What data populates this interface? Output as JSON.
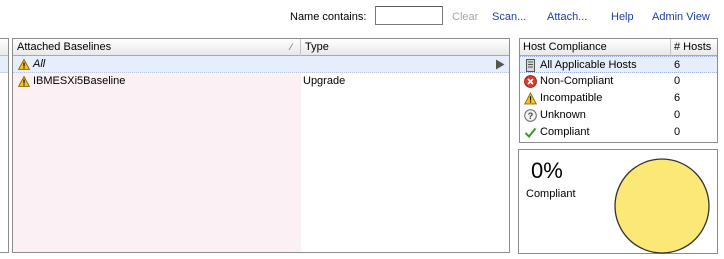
{
  "toolbar": {
    "name_contains_label": "Name contains:",
    "name_contains_value": "",
    "clear_label": "Clear",
    "scan_label": "Scan...",
    "attach_label": "Attach...",
    "help_label": "Help",
    "admin_view_label": "Admin View"
  },
  "baselines": {
    "columns": [
      "Attached Baselines",
      "Type"
    ],
    "sort_indicator": "⁄",
    "rows": [
      {
        "name": "All",
        "type": "",
        "icon": "warning-icon"
      },
      {
        "name": "IBMESXi5Baseline",
        "type": "Upgrade",
        "icon": "warning-icon"
      }
    ]
  },
  "host_compliance": {
    "columns": [
      "Host Compliance",
      "# Hosts"
    ],
    "rows": [
      {
        "label": "All Applicable Hosts",
        "count": "6",
        "icon": "host-icon"
      },
      {
        "label": "Non-Compliant",
        "count": "0",
        "icon": "error-icon"
      },
      {
        "label": "Incompatible",
        "count": "6",
        "icon": "warning-icon"
      },
      {
        "label": "Unknown",
        "count": "0",
        "icon": "unknown-icon"
      },
      {
        "label": "Compliant",
        "count": "0",
        "icon": "check-icon"
      }
    ]
  },
  "compliance_chart": {
    "percent_text": "0%",
    "label": "Compliant",
    "compliant_fraction": 0,
    "fill_color": "#fce877"
  },
  "colors": {
    "link": "#1c3fa8",
    "link_disabled": "#a6a6a6",
    "selection": "#e6eefb",
    "warning": "#f6c21a",
    "error": "#d93a2a",
    "check": "#3a9a2c"
  }
}
